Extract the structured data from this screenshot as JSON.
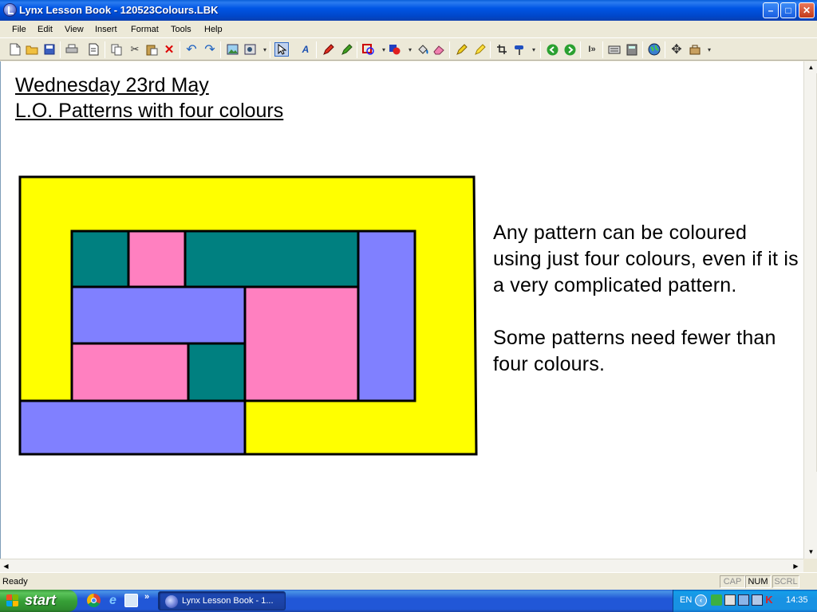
{
  "window": {
    "title": "Lynx Lesson Book - 120523Colours.LBK"
  },
  "menu": [
    "File",
    "Edit",
    "View",
    "Insert",
    "Format",
    "Tools",
    "Help"
  ],
  "toolbar_icons": [
    "new-icon",
    "open-icon",
    "save-icon",
    "print-icon",
    "page-icon",
    "copy-icon",
    "cut-icon",
    "paste-icon",
    "delete-icon",
    "undo-icon",
    "redo-icon",
    "insert-picture-icon",
    "picture-options-icon",
    "select-arrow-icon",
    "font-icon",
    "pencil-icon",
    "pen-icon",
    "shape-icon",
    "fill-colour-icon",
    "paint-bucket-icon",
    "eraser-icon",
    "highlighter-icon",
    "marker-icon",
    "crop-icon",
    "format-painter-icon",
    "back-icon",
    "forward-icon",
    "speech-icon",
    "keyboard-icon",
    "calculator-icon",
    "globe-icon",
    "move-icon",
    "tools-icon"
  ],
  "document": {
    "heading_date": "Wednesday 23rd May",
    "heading_lo": "L.O. Patterns with four colours",
    "paragraph1": "Any pattern can be coloured using just four colours, even if it is a very  complicated pattern.",
    "paragraph2": "Some patterns need fewer than four colours."
  },
  "pattern_colours": {
    "yellow": "#ffff00",
    "teal": "#008080",
    "pink": "#ff80c0",
    "periwinkle": "#8080ff",
    "outline": "#000000"
  },
  "status": {
    "text": "Ready",
    "cap": "CAP",
    "num": "NUM",
    "scrl": "SCRL"
  },
  "taskbar": {
    "start": "start",
    "task_label": "Lynx Lesson Book - 1...",
    "language": "EN",
    "clock": "14:35",
    "quick_launch_icons": [
      "chrome-icon",
      "internet-explorer-icon",
      "show-desktop-icon"
    ]
  },
  "colors": {
    "titlebar": "#0054e3",
    "start_green": "#37a037",
    "taskbar_blue": "#2157d7"
  }
}
